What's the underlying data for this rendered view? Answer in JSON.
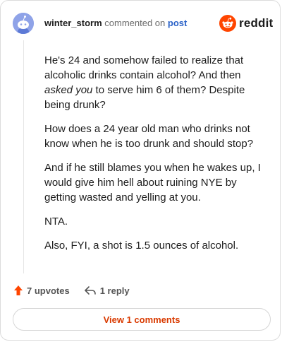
{
  "comment": {
    "username": "winter_storm",
    "action_text": "commented on",
    "target_link": "post",
    "paragraphs": {
      "p1_before": "He's 24 and somehow failed to realize that alcoholic drinks contain alcohol? And then ",
      "p1_emph": "asked you",
      "p1_after": " to serve him 6 of them? Despite being drunk?",
      "p2": "How does a 24 year old man who drinks not know when he is too drunk and should stop?",
      "p3": "And if he still blames you when he wakes up, I would give him hell about ruining NYE by getting wasted and yelling at you.",
      "p4": "NTA.",
      "p5": "Also, FYI, a shot is 1.5 ounces of alcohol."
    }
  },
  "branding": {
    "logo_text": "reddit",
    "icon": "reddit-alien-icon",
    "color": "#ff4500"
  },
  "actions": {
    "upvotes_label": "7 upvotes",
    "replies_label": "1 reply",
    "upvote_icon": "upvote-arrow-icon",
    "reply_icon": "reply-arrow-icon",
    "upvote_color": "#ff4500"
  },
  "view_comments_label": "View 1 comments"
}
